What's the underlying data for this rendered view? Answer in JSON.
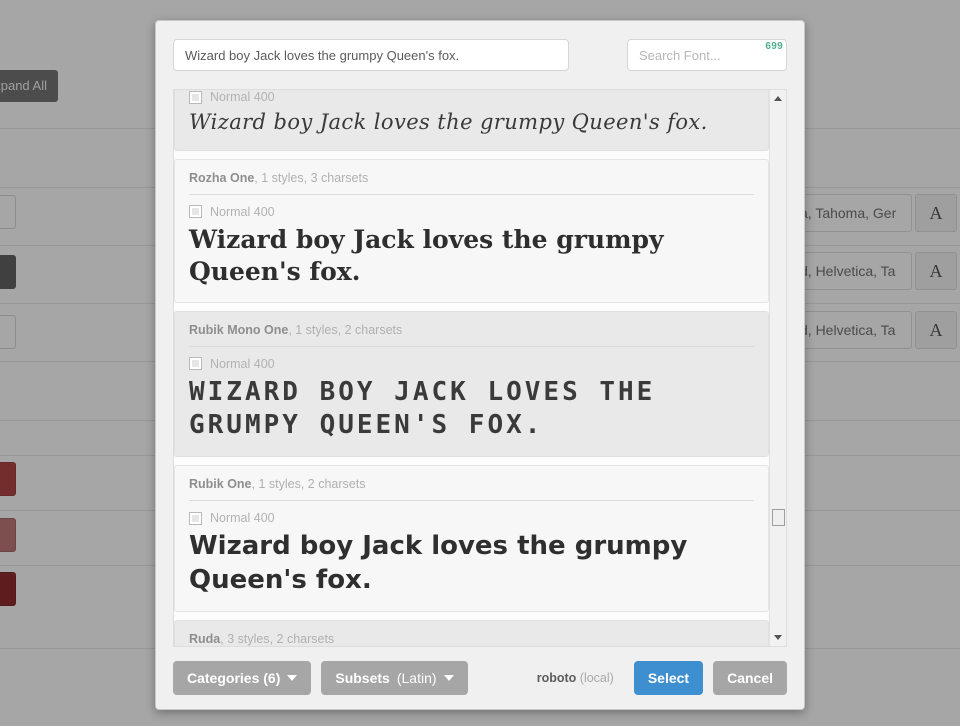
{
  "background": {
    "expand_all_label": "Expand All",
    "rows": [
      {
        "value": "a, Tahoma, Ger",
        "button": "A"
      },
      {
        "value": "d, Helvetica, Ta",
        "button": "A"
      },
      {
        "value": "d, Helvetica, Ta",
        "button": "A"
      }
    ],
    "swatches": [
      "#a32020",
      "#b45f5f",
      "#7a0000"
    ]
  },
  "modal": {
    "sample_text": "Wizard boy Jack loves the grumpy Queen's fox.",
    "search": {
      "placeholder": "Search Font...",
      "value": "",
      "result_count": "699",
      "count_color": "#4fae8f"
    },
    "fonts": [
      {
        "name": "",
        "meta": "",
        "partial": true,
        "shade": "shade",
        "style_label": "Normal 400",
        "preview": "Wizard boy Jack loves the grumpy Queen's fox.",
        "preview_class": "pv-script"
      },
      {
        "name": "Rozha One",
        "meta": ", 1 styles, 3 charsets",
        "partial": false,
        "shade": "light",
        "style_label": "Normal 400",
        "preview": "Wizard boy Jack loves the grumpy Queen's fox.",
        "preview_class": "pv-serif"
      },
      {
        "name": "Rubik Mono One",
        "meta": ", 1 styles, 2 charsets",
        "partial": false,
        "shade": "shade",
        "style_label": "Normal 400",
        "preview": "Wizard boy Jack loves the grumpy Queen's fox.",
        "preview_class": "pv-mono"
      },
      {
        "name": "Rubik One",
        "meta": ", 1 styles, 2 charsets",
        "partial": false,
        "shade": "light",
        "style_label": "Normal 400",
        "preview": "Wizard boy Jack loves the grumpy Queen's fox.",
        "preview_class": "pv-bold"
      },
      {
        "name": "Ruda",
        "meta": ", 3 styles, 2 charsets",
        "partial": false,
        "shade": "shade",
        "style_label": "",
        "preview": "",
        "preview_class": "pv-bold"
      }
    ],
    "footer": {
      "categories_label": "Categories (6)",
      "subsets_label": "Subsets",
      "subsets_value": "(Latin)",
      "local_font_name": "roboto",
      "local_font_suffix": " (local)",
      "select_label": "Select",
      "cancel_label": "Cancel",
      "select_color": "#3e8fd0"
    }
  }
}
